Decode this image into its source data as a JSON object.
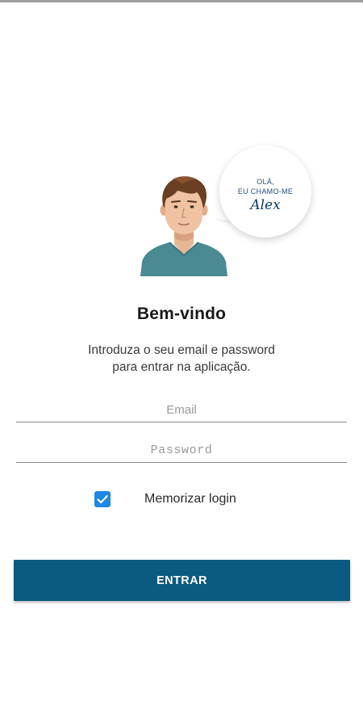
{
  "illustration": {
    "greeting_line1": "OLÁ,",
    "greeting_line2": "EU CHAMO-ME",
    "mascot_name": "Alex",
    "avatar_icon": "avatar-illustration",
    "shirt_color": "#4a8a93",
    "hair_color": "#6b3f22"
  },
  "welcome": {
    "title": "Bem-vindo",
    "subtitle_line1": "Introduza o seu email e password",
    "subtitle_line2": "para entrar na aplicação."
  },
  "form": {
    "email_placeholder": "Email",
    "email_value": "",
    "password_placeholder": "Password",
    "password_value": "",
    "remember_label": "Memorizar login",
    "remember_checked": true,
    "checkbox_icon": "check-icon",
    "submit_label": "ENTRAR"
  },
  "colors": {
    "primary": "#0b5a7f",
    "checkbox": "#1e88e5",
    "bubble_text": "#1f4e79"
  }
}
